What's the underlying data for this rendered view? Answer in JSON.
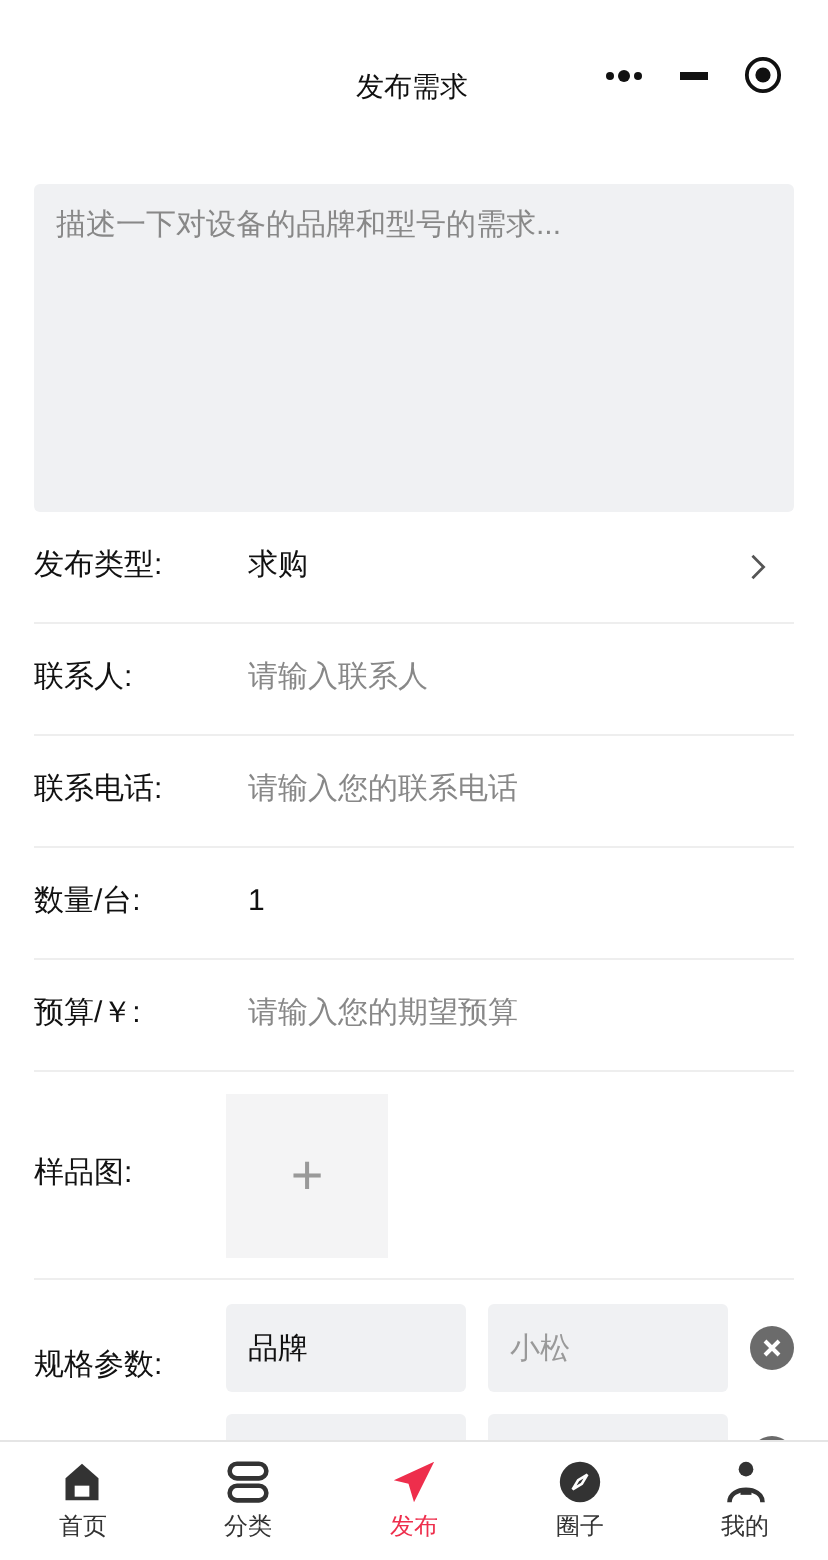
{
  "window": {
    "title": "发布需求"
  },
  "description": {
    "placeholder": "描述一下对设备的品牌和型号的需求..."
  },
  "fields": [
    {
      "kind": "picker",
      "label": "发布类型:",
      "value": "求购"
    },
    {
      "kind": "input",
      "label": "联系人:",
      "placeholder": "请输入联系人"
    },
    {
      "kind": "input",
      "label": "联系电话:",
      "placeholder": "请输入您的联系电话"
    },
    {
      "kind": "input",
      "label": "数量/台:",
      "value": "1"
    },
    {
      "kind": "input",
      "label": "预算/￥:",
      "placeholder": "请输入您的期望预算"
    }
  ],
  "sample_image": {
    "label": "样品图:",
    "add": "+"
  },
  "specs": {
    "label": "规格参数:",
    "rows": [
      {
        "kind": "filled",
        "name": "品牌",
        "placeholder": "小松"
      },
      {
        "kind": "blank"
      }
    ]
  },
  "tab_bar": [
    {
      "label": "首页",
      "selected": false
    },
    {
      "label": "分类",
      "selected": false
    },
    {
      "label": "发布",
      "selected": true
    },
    {
      "label": "圈子",
      "selected": false
    },
    {
      "label": "我的",
      "selected": false
    }
  ]
}
